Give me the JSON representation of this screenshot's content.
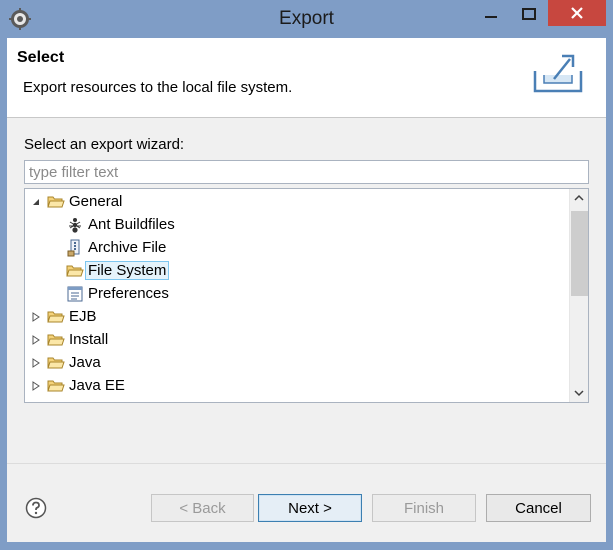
{
  "window": {
    "title": "Export"
  },
  "banner": {
    "title": "Select",
    "description": "Export resources to the local file system."
  },
  "wizard": {
    "prompt": "Select an export wizard:",
    "filter_placeholder": "type filter text",
    "tree": [
      {
        "label": "General",
        "expanded": true,
        "icon": "folder-open-icon"
      },
      {
        "label": "Ant Buildfiles",
        "icon": "ant-icon"
      },
      {
        "label": "Archive File",
        "icon": "archive-icon"
      },
      {
        "label": "File System",
        "icon": "folder-open-icon",
        "selected": true
      },
      {
        "label": "Preferences",
        "icon": "preferences-icon"
      },
      {
        "label": "EJB",
        "expanded": false,
        "icon": "folder-open-icon"
      },
      {
        "label": "Install",
        "expanded": false,
        "icon": "folder-open-icon"
      },
      {
        "label": "Java",
        "expanded": false,
        "icon": "folder-open-icon"
      },
      {
        "label": "Java EE",
        "expanded": false,
        "icon": "folder-open-icon"
      }
    ]
  },
  "buttons": {
    "back": "< Back",
    "next": "Next >",
    "finish": "Finish",
    "cancel": "Cancel"
  },
  "colors": {
    "titlebar": "#7f9dc6",
    "close": "#c7473f",
    "selection": "#e5f3fb",
    "default_button_border": "#3c7fb1"
  }
}
